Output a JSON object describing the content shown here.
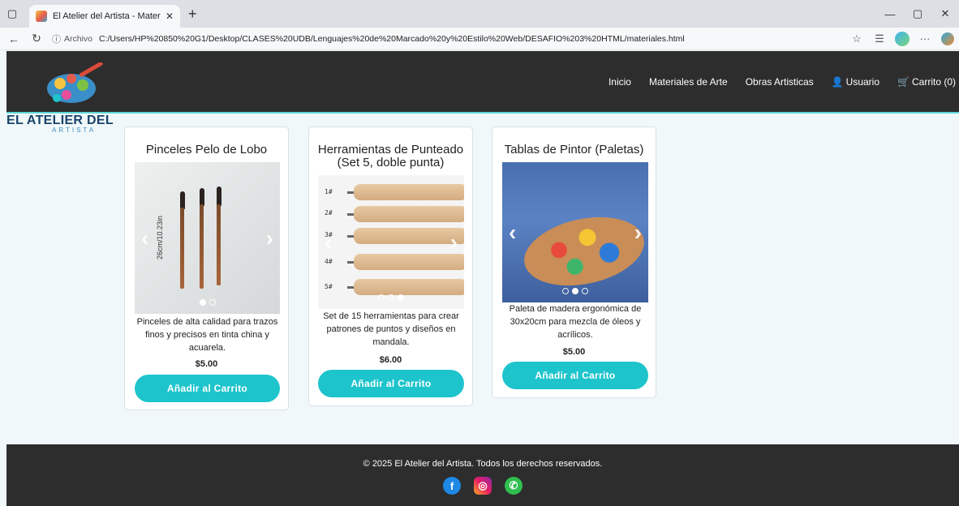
{
  "browser": {
    "tab_title": "El Atelier del Artista - Materiales",
    "address_label": "Archivo",
    "url": "C:/Users/HP%20850%20G1/Desktop/CLASES%20UDB/Lenguajes%20de%20Marcado%20y%20Estilo%20Web/DESAFIO%203%20HTML/materiales.html"
  },
  "site": {
    "logo_line1": "EL ATELIER DEL",
    "logo_line2": "ARTISTA",
    "nav": {
      "inicio": "Inicio",
      "materiales": "Materiales de Arte",
      "obras": "Obras Artisticas",
      "usuario": "Usuario",
      "carrito": "Carrito (0)"
    }
  },
  "products": [
    {
      "title": "Pinceles Pelo de Lobo",
      "image_text": "26cm/10.23in",
      "description": "Pinceles de alta calidad para trazos finos y precisos en tinta china y acuarela.",
      "price": "$5.00",
      "button": "Añadir al Carrito"
    },
    {
      "title": "Herramientas de Punteado (Set 5, doble punta)",
      "image_labels": [
        "1#",
        "2#",
        "3#",
        "4#",
        "5#"
      ],
      "description": "Set de 15 herramientas para crear patrones de puntos y diseños en mandala.",
      "price": "$6.00",
      "button": "Añadir al Carrito"
    },
    {
      "title": "Tablas de Pintor (Paletas)",
      "description": "Paleta de madera ergonómica de 30x20cm para mezcla de óleos y acrílicos.",
      "price": "$5.00",
      "button": "Añadir al Carrito"
    }
  ],
  "footer": {
    "copyright": "© 2025 El Atelier del Artista. Todos los derechos reservados."
  },
  "colors": {
    "accent": "#1ec4cc",
    "header_bg": "#2d2d2d",
    "page_bg": "#f0f8f9"
  }
}
